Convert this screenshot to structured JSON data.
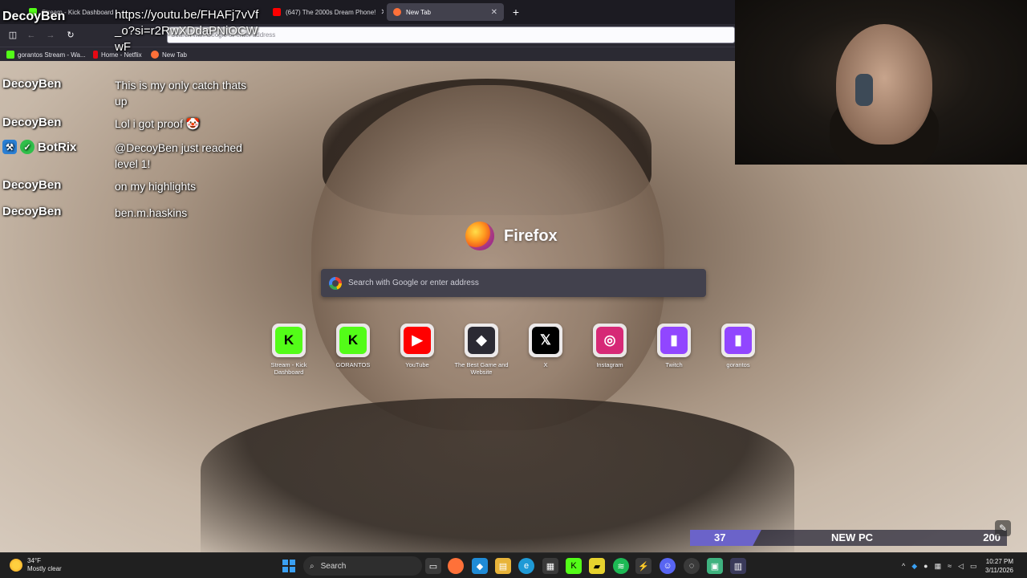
{
  "stream": {
    "channel_name": "DecoyBen",
    "chat_link": "https://youtu.be/FHAFj7vVf_o?si=r2RwXDdaPNiOCWwF",
    "chat": [
      {
        "user": "DecoyBen",
        "message": "This is my only catch thats up"
      },
      {
        "user": "DecoyBen",
        "message": "Lol i got proof 🤡"
      },
      {
        "user": "BotRix",
        "message": "@DecoyBen just reached level 1!"
      },
      {
        "user": "DecoyBen",
        "message": "on my highlights"
      },
      {
        "user": "DecoyBen",
        "message": "ben.m.haskins"
      }
    ],
    "goal": {
      "current": "37",
      "title": "NEW PC",
      "target": "200",
      "progress": 0.185,
      "color": "#6b63c9"
    }
  },
  "browser": {
    "tabs": [
      {
        "title": "Stream - Kick Dashboard",
        "color": "#53fc18",
        "active": false
      },
      {
        "title": "(647) The 2000s Dream Phone!",
        "color": "#ff0000",
        "active": false
      },
      {
        "title": "New Tab",
        "color": "#ff7139",
        "active": true
      }
    ],
    "new_tab_symbol": "+",
    "url_placeholder": "Search with Google or enter address",
    "bookmarks": [
      {
        "title": "gorantos Stream - Wa...",
        "color": "#53fc18"
      },
      {
        "title": "Home - Netflix",
        "color": "#e50914"
      },
      {
        "title": "New Tab",
        "color": "#ff7139"
      }
    ]
  },
  "newtab": {
    "brand_name": "Firefox",
    "search_placeholder": "Search with Google or enter address",
    "shortcuts": [
      {
        "label": "Stream - Kick Dashboard",
        "glyph": "K",
        "bg": "#53fc18",
        "fg": "#000000"
      },
      {
        "label": "GORANTOS",
        "glyph": "K",
        "bg": "#53fc18",
        "fg": "#000000"
      },
      {
        "label": "YouTube",
        "glyph": "▶",
        "bg": "#ff0000",
        "fg": "#ffffff"
      },
      {
        "label": "The Best Game and Website",
        "glyph": "◆",
        "bg": "#2b2a33",
        "fg": "#ffffff"
      },
      {
        "label": "X",
        "glyph": "𝕏",
        "bg": "#000000",
        "fg": "#ffffff"
      },
      {
        "label": "Instagram",
        "glyph": "◎",
        "bg": "#d62976",
        "fg": "#ffffff"
      },
      {
        "label": "Twitch",
        "glyph": "▮",
        "bg": "#9146ff",
        "fg": "#ffffff"
      },
      {
        "label": "gorantos",
        "glyph": "▮",
        "bg": "#9146ff",
        "fg": "#ffffff"
      }
    ]
  },
  "taskbar": {
    "weather_temp": "34°F",
    "weather_desc": "Mostly clear",
    "search_label": "Search",
    "time": "10:27 PM",
    "date": "3/11/2026"
  }
}
